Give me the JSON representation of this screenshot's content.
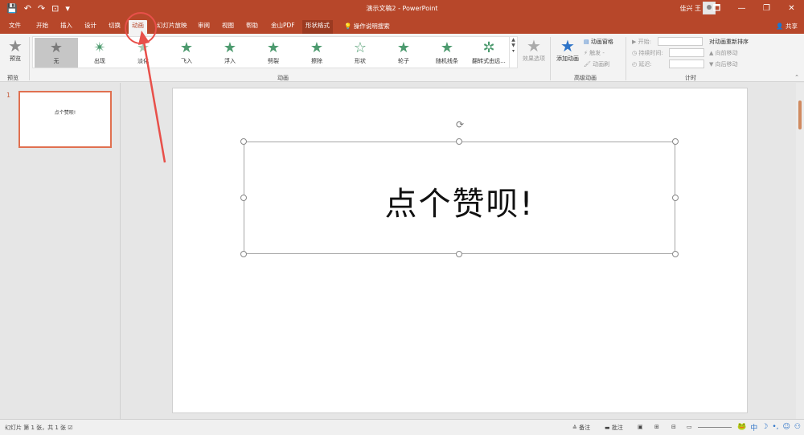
{
  "titlebar": {
    "qat": [
      "💾",
      "↶",
      "↷",
      "⊡",
      "▾"
    ],
    "doc_title": "演示文稿2 - PowerPoint",
    "user": "佳兴 王",
    "controls": [
      "🗖",
      "—",
      "❐",
      "✕"
    ]
  },
  "tabs": [
    {
      "label": "文件",
      "state": "normal"
    },
    {
      "label": "开始",
      "state": "normal"
    },
    {
      "label": "插入",
      "state": "normal"
    },
    {
      "label": "设计",
      "state": "normal"
    },
    {
      "label": "切换",
      "state": "normal"
    },
    {
      "label": "动画",
      "state": "active"
    },
    {
      "label": "幻灯片放映",
      "state": "normal"
    },
    {
      "label": "审阅",
      "state": "normal"
    },
    {
      "label": "视图",
      "state": "normal"
    },
    {
      "label": "帮助",
      "state": "normal"
    },
    {
      "label": "金山PDF",
      "state": "normal"
    },
    {
      "label": "形状格式",
      "state": "context"
    }
  ],
  "tab_search": "操作说明搜索",
  "share": "共享",
  "ribbon": {
    "preview": {
      "label": "预览",
      "group": "预览"
    },
    "gallery": {
      "group": "动画",
      "items": [
        {
          "label": "无",
          "selected": true
        },
        {
          "label": "出现",
          "selected": false
        },
        {
          "label": "淡化",
          "selected": false
        },
        {
          "label": "飞入",
          "selected": false
        },
        {
          "label": "浮入",
          "selected": false
        },
        {
          "label": "劈裂",
          "selected": false
        },
        {
          "label": "擦除",
          "selected": false
        },
        {
          "label": "形状",
          "selected": false
        },
        {
          "label": "轮子",
          "selected": false
        },
        {
          "label": "随机线条",
          "selected": false
        },
        {
          "label": "翻转式由远...",
          "selected": false
        }
      ]
    },
    "effect_options": "效果选项",
    "advanced": {
      "group": "高级动画",
      "add_animation": "添加动画",
      "animation_pane": "动画窗格",
      "trigger": "触发 -",
      "painter": "动画刷"
    },
    "timing": {
      "group": "计时",
      "start": "开始:",
      "duration": "持续时间:",
      "delay": "延迟:",
      "reorder": "对动画重新排序",
      "move_earlier": "向前移动",
      "move_later": "向后移动"
    }
  },
  "thumbnail": {
    "number": "1",
    "text": "点个赞呗!"
  },
  "slide": {
    "title": "点个赞呗!"
  },
  "statusbar": {
    "slide_info": "幻灯片 第 1 张，共 1 张",
    "notes": "备注",
    "comments": "批注"
  },
  "ime": {
    "mode": "中"
  },
  "colors": {
    "accent": "#b7472a",
    "annotation": "#e8504a",
    "ribbon_bg": "#f3f3f3"
  }
}
